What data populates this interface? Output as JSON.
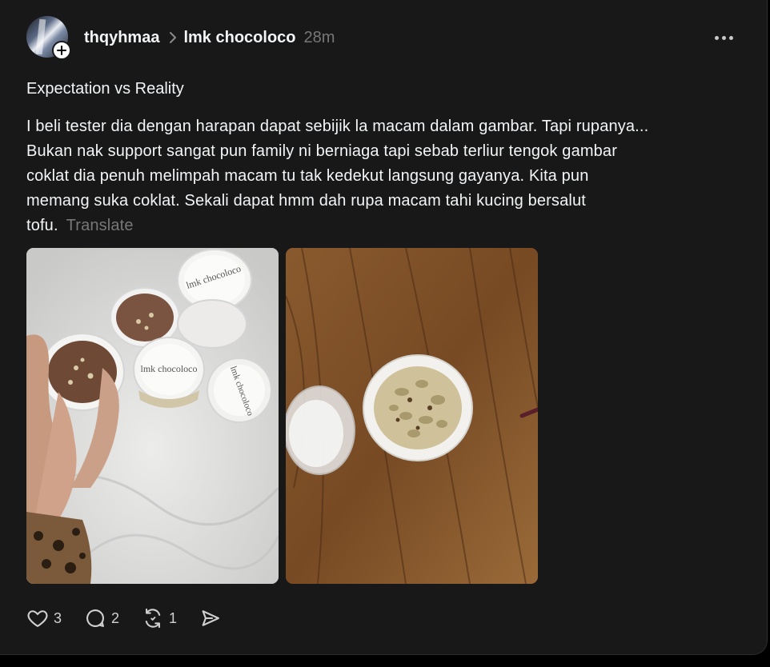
{
  "post": {
    "author": "thqyhmaa",
    "community": "lmk chocoloco",
    "time": "28m",
    "title": "Expectation vs Reality",
    "body_lines": [
      "I beli tester dia dengan harapan dapat sebijik la macam dalam gambar. Tapi rupanya...",
      "Bukan nak support sangat pun family ni berniaga tapi sebab terliur tengok gambar",
      "coklat dia penuh melimpah macam tu tak kedekut langsung gayanya. Kita pun",
      "memang suka coklat. Sekali dapat hmm dah rupa macam tahi kucing bersalut",
      "tofu."
    ],
    "translate_label": "Translate",
    "product_label": "lmk chocoloco"
  },
  "actions": {
    "likes": "3",
    "comments": "2",
    "reposts": "1"
  },
  "icons": {
    "like": "heart-icon",
    "comment": "comment-bubble-icon",
    "repost": "repost-icon",
    "share": "send-icon",
    "more": "more-dots-icon",
    "follow": "plus-icon",
    "breadcrumb": "chevron-right-icon"
  },
  "colors": {
    "background": "#181818",
    "text": "#f3f5f7",
    "muted": "#777777"
  }
}
